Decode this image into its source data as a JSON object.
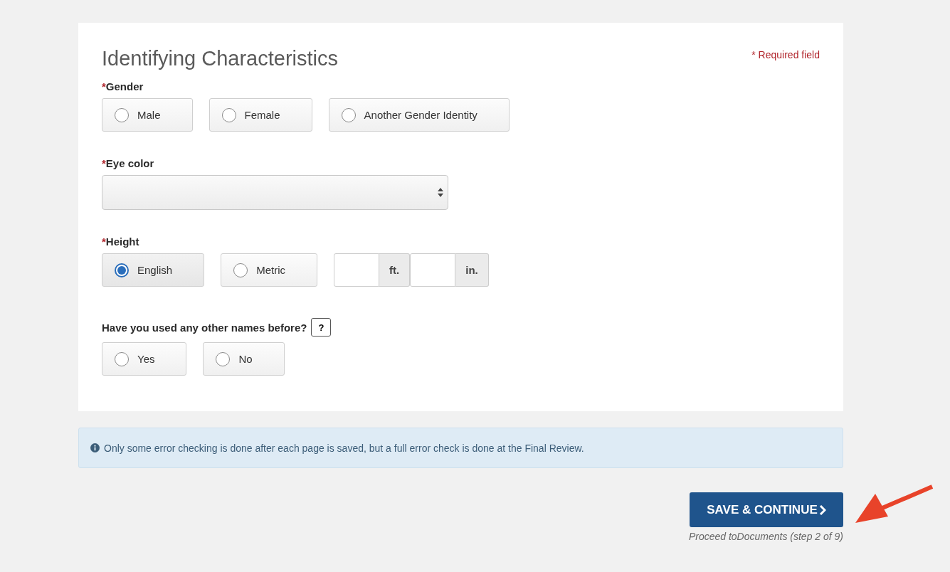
{
  "page": {
    "title": "Identifying Characteristics",
    "required_note": "* Required field"
  },
  "fields": [
    {
      "kind": "radio",
      "marker": "*",
      "label": "Gender",
      "options": [
        {
          "label": "Male",
          "selected": false
        },
        {
          "label": "Female",
          "selected": false
        },
        {
          "label": "Another Gender Identity",
          "selected": false
        }
      ]
    },
    {
      "kind": "select",
      "marker": "*",
      "label": "Eye color"
    },
    {
      "kind": "height",
      "marker": "*",
      "label": "Height",
      "options": [
        {
          "label": "English",
          "selected": true
        },
        {
          "label": "Metric",
          "selected": false
        }
      ],
      "inputs": [
        {
          "unit": "ft."
        },
        {
          "unit": "in."
        }
      ]
    },
    {
      "kind": "radio",
      "label": "Have you used any other names before?",
      "help": "?",
      "options": [
        {
          "label": "Yes",
          "selected": false
        },
        {
          "label": "No",
          "selected": false
        }
      ]
    }
  ],
  "notice": "Only some error checking is done after each page is saved, but a full error check is done at the Final Review.",
  "submit": {
    "label": "SAVE & CONTINUE",
    "caption": "Proceed toDocuments (step 2 of 9)"
  }
}
